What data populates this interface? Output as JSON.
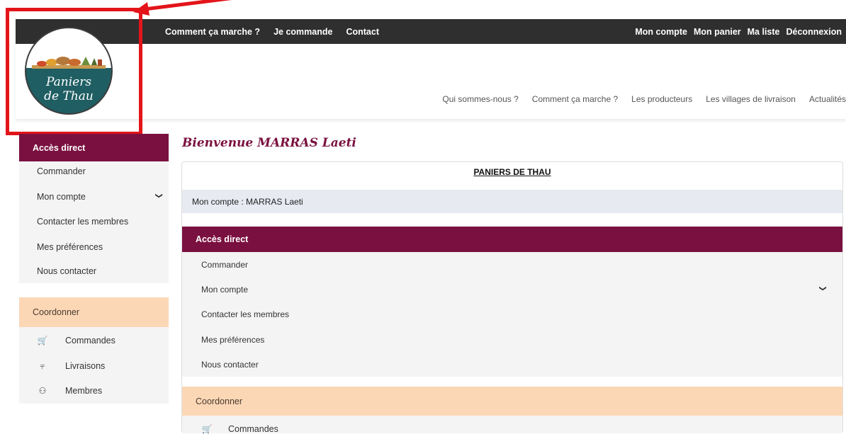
{
  "topnav": {
    "left": [
      "Comment ça marche ?",
      "Je commande",
      "Contact"
    ],
    "right": [
      "Mon compte",
      "Mon panier",
      "Ma liste",
      "Déconnexion"
    ]
  },
  "logo": {
    "line1": "Paniers",
    "line2": "de Thau"
  },
  "mainnav": [
    "Qui sommes-nous ?",
    "Comment ça marche ?",
    "Les producteurs",
    "Les villages de livraison",
    "Actualités"
  ],
  "sidebar": {
    "section1": "Accès direct",
    "items": [
      "Commander",
      "Mon compte",
      "Contacter les membres",
      "Mes préférences",
      "Nous contacter"
    ],
    "section2": "Coordonner",
    "items2": [
      {
        "label": "Commandes",
        "icon": "cart-icon"
      },
      {
        "label": "Livraisons",
        "icon": "dolly-icon"
      },
      {
        "label": "Membres",
        "icon": "users-icon"
      }
    ]
  },
  "main": {
    "welcome": "Bienvenue MARRAS Laeti",
    "panel_title": "PANIERS DE THAU",
    "account": "Mon compte : MARRAS Laeti",
    "section1": "Accès direct",
    "items": [
      "Commander",
      "Mon compte",
      "Contacter les membres",
      "Mes préférences",
      "Nous contacter"
    ],
    "section2": "Coordonner",
    "items2": [
      {
        "label": "Commandes",
        "icon": "cart-icon"
      }
    ]
  },
  "colors": {
    "brand": "#7a1040",
    "peach": "#fcd7b6",
    "topbar": "#2f2f2f",
    "annotation": "#e3141a"
  }
}
